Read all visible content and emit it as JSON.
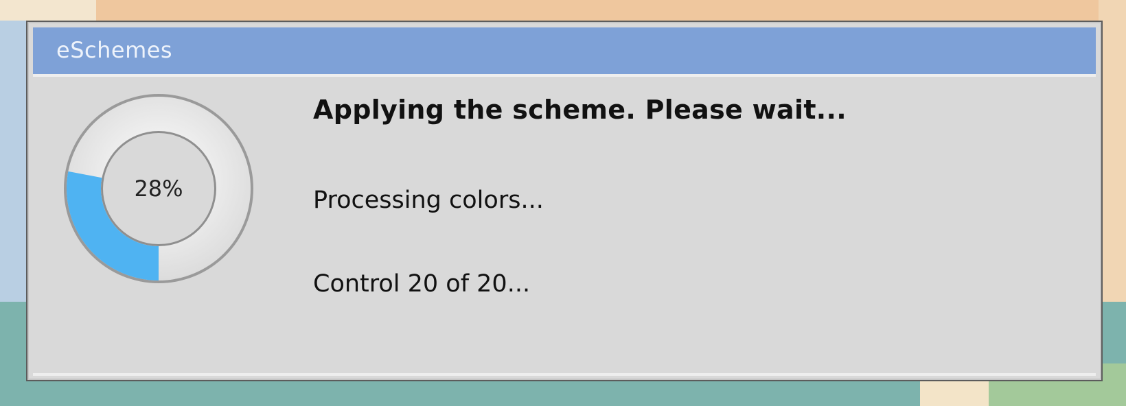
{
  "window": {
    "title": "eSchemes"
  },
  "progress": {
    "percent_label": "28%",
    "fraction": 0.28,
    "fill_color": "#4fb3f2",
    "track_color": "#f2f2f2"
  },
  "messages": {
    "title": "Applying the scheme. Please wait...",
    "status": "Processing colors...",
    "detail": "Control 20 of 20..."
  },
  "colors": {
    "titlebar": "#7ea1d7",
    "dialog_bg": "#d9d9d9"
  }
}
